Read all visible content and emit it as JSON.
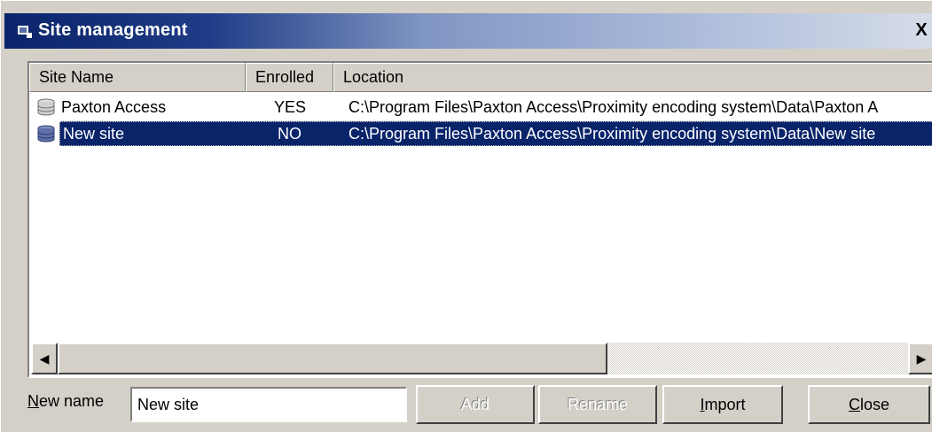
{
  "window": {
    "title": "Site management",
    "close_glyph": "X",
    "title_bar_color": "#0a246a"
  },
  "list": {
    "columns": [
      "Site Name",
      "Enrolled",
      "Location"
    ],
    "rows": [
      {
        "site_name": "Paxton Access",
        "enrolled": "YES",
        "location": "C:\\Program Files\\Paxton Access\\Proximity encoding system\\Data\\Paxton A",
        "icon": "database-icon",
        "selected": false
      },
      {
        "site_name": "New site",
        "enrolled": "NO",
        "location": "C:\\Program Files\\Paxton Access\\Proximity encoding system\\Data\\New site",
        "icon": "database-icon",
        "selected": true
      }
    ],
    "selection_color": "#0a246a"
  },
  "scrollbar": {
    "left_arrow": "◀",
    "right_arrow": "▶"
  },
  "form": {
    "new_name_label_underlined": "N",
    "new_name_label_rest": "ew name",
    "new_name_value": "New site"
  },
  "buttons": {
    "add": {
      "label": "Add",
      "enabled": false
    },
    "rename": {
      "label": "Rename",
      "enabled": false
    },
    "import": {
      "label_underlined": "I",
      "label_rest": "mport",
      "enabled": true
    },
    "close": {
      "label_underlined": "C",
      "label_rest": "lose",
      "enabled": true
    }
  }
}
